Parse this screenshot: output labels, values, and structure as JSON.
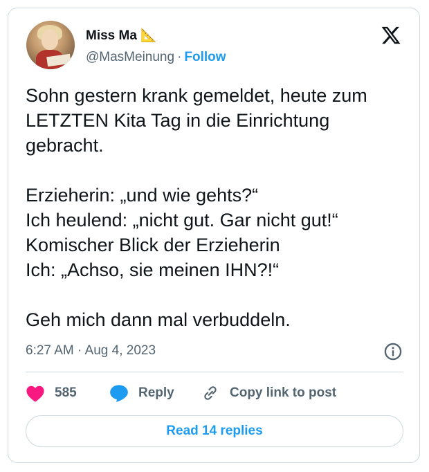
{
  "author": {
    "name": "Miss Ma 📐",
    "handle": "@MasMeinung",
    "separator": "·",
    "follow_label": "Follow"
  },
  "tweet": {
    "text": "Sohn gestern krank gemeldet, heute zum\nLETZTEN Kita Tag in die Einrichtung\ngebracht.\n\nErzieherin: „und wie gehts?“\nIch heulend: „nicht gut. Gar nicht gut!“\nKomischer Blick der Erzieherin\nIch: „Achso, sie meinen IHN?!“\n\nGeh mich dann mal verbuddeln.",
    "timestamp": "6:27 AM · Aug 4, 2023"
  },
  "actions": {
    "like_count": "585",
    "reply_label": "Reply",
    "copy_label": "Copy link to post"
  },
  "read_replies_label": "Read 14 replies",
  "icons": {
    "brand": "x-logo-icon",
    "info": "info-icon",
    "like": "heart-icon",
    "reply": "speech-bubble-icon",
    "copy": "link-icon"
  },
  "colors": {
    "accent": "#1d9bf0",
    "like": "#f91880",
    "text": "#0f1419",
    "muted": "#536471",
    "border": "#cfd9de"
  }
}
